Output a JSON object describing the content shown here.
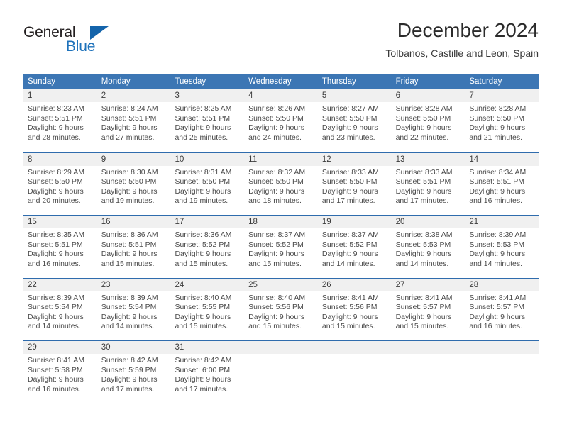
{
  "brand": {
    "name_part1": "General",
    "name_part2": "Blue",
    "accent_color": "#1464ab"
  },
  "header": {
    "title": "December 2024",
    "subtitle": "Tolbanos, Castille and Leon, Spain"
  },
  "theme": {
    "header_blue": "#3c76b4",
    "separator_blue": "#2f6cad",
    "daynum_band": "#f0f0f0"
  },
  "weekdays": [
    "Sunday",
    "Monday",
    "Tuesday",
    "Wednesday",
    "Thursday",
    "Friday",
    "Saturday"
  ],
  "weeks": [
    [
      {
        "day": "1",
        "sunrise": "Sunrise: 8:23 AM",
        "sunset": "Sunset: 5:51 PM",
        "daylight_1": "Daylight: 9 hours",
        "daylight_2": "and 28 minutes."
      },
      {
        "day": "2",
        "sunrise": "Sunrise: 8:24 AM",
        "sunset": "Sunset: 5:51 PM",
        "daylight_1": "Daylight: 9 hours",
        "daylight_2": "and 27 minutes."
      },
      {
        "day": "3",
        "sunrise": "Sunrise: 8:25 AM",
        "sunset": "Sunset: 5:51 PM",
        "daylight_1": "Daylight: 9 hours",
        "daylight_2": "and 25 minutes."
      },
      {
        "day": "4",
        "sunrise": "Sunrise: 8:26 AM",
        "sunset": "Sunset: 5:50 PM",
        "daylight_1": "Daylight: 9 hours",
        "daylight_2": "and 24 minutes."
      },
      {
        "day": "5",
        "sunrise": "Sunrise: 8:27 AM",
        "sunset": "Sunset: 5:50 PM",
        "daylight_1": "Daylight: 9 hours",
        "daylight_2": "and 23 minutes."
      },
      {
        "day": "6",
        "sunrise": "Sunrise: 8:28 AM",
        "sunset": "Sunset: 5:50 PM",
        "daylight_1": "Daylight: 9 hours",
        "daylight_2": "and 22 minutes."
      },
      {
        "day": "7",
        "sunrise": "Sunrise: 8:28 AM",
        "sunset": "Sunset: 5:50 PM",
        "daylight_1": "Daylight: 9 hours",
        "daylight_2": "and 21 minutes."
      }
    ],
    [
      {
        "day": "8",
        "sunrise": "Sunrise: 8:29 AM",
        "sunset": "Sunset: 5:50 PM",
        "daylight_1": "Daylight: 9 hours",
        "daylight_2": "and 20 minutes."
      },
      {
        "day": "9",
        "sunrise": "Sunrise: 8:30 AM",
        "sunset": "Sunset: 5:50 PM",
        "daylight_1": "Daylight: 9 hours",
        "daylight_2": "and 19 minutes."
      },
      {
        "day": "10",
        "sunrise": "Sunrise: 8:31 AM",
        "sunset": "Sunset: 5:50 PM",
        "daylight_1": "Daylight: 9 hours",
        "daylight_2": "and 19 minutes."
      },
      {
        "day": "11",
        "sunrise": "Sunrise: 8:32 AM",
        "sunset": "Sunset: 5:50 PM",
        "daylight_1": "Daylight: 9 hours",
        "daylight_2": "and 18 minutes."
      },
      {
        "day": "12",
        "sunrise": "Sunrise: 8:33 AM",
        "sunset": "Sunset: 5:50 PM",
        "daylight_1": "Daylight: 9 hours",
        "daylight_2": "and 17 minutes."
      },
      {
        "day": "13",
        "sunrise": "Sunrise: 8:33 AM",
        "sunset": "Sunset: 5:51 PM",
        "daylight_1": "Daylight: 9 hours",
        "daylight_2": "and 17 minutes."
      },
      {
        "day": "14",
        "sunrise": "Sunrise: 8:34 AM",
        "sunset": "Sunset: 5:51 PM",
        "daylight_1": "Daylight: 9 hours",
        "daylight_2": "and 16 minutes."
      }
    ],
    [
      {
        "day": "15",
        "sunrise": "Sunrise: 8:35 AM",
        "sunset": "Sunset: 5:51 PM",
        "daylight_1": "Daylight: 9 hours",
        "daylight_2": "and 16 minutes."
      },
      {
        "day": "16",
        "sunrise": "Sunrise: 8:36 AM",
        "sunset": "Sunset: 5:51 PM",
        "daylight_1": "Daylight: 9 hours",
        "daylight_2": "and 15 minutes."
      },
      {
        "day": "17",
        "sunrise": "Sunrise: 8:36 AM",
        "sunset": "Sunset: 5:52 PM",
        "daylight_1": "Daylight: 9 hours",
        "daylight_2": "and 15 minutes."
      },
      {
        "day": "18",
        "sunrise": "Sunrise: 8:37 AM",
        "sunset": "Sunset: 5:52 PM",
        "daylight_1": "Daylight: 9 hours",
        "daylight_2": "and 15 minutes."
      },
      {
        "day": "19",
        "sunrise": "Sunrise: 8:37 AM",
        "sunset": "Sunset: 5:52 PM",
        "daylight_1": "Daylight: 9 hours",
        "daylight_2": "and 14 minutes."
      },
      {
        "day": "20",
        "sunrise": "Sunrise: 8:38 AM",
        "sunset": "Sunset: 5:53 PM",
        "daylight_1": "Daylight: 9 hours",
        "daylight_2": "and 14 minutes."
      },
      {
        "day": "21",
        "sunrise": "Sunrise: 8:39 AM",
        "sunset": "Sunset: 5:53 PM",
        "daylight_1": "Daylight: 9 hours",
        "daylight_2": "and 14 minutes."
      }
    ],
    [
      {
        "day": "22",
        "sunrise": "Sunrise: 8:39 AM",
        "sunset": "Sunset: 5:54 PM",
        "daylight_1": "Daylight: 9 hours",
        "daylight_2": "and 14 minutes."
      },
      {
        "day": "23",
        "sunrise": "Sunrise: 8:39 AM",
        "sunset": "Sunset: 5:54 PM",
        "daylight_1": "Daylight: 9 hours",
        "daylight_2": "and 14 minutes."
      },
      {
        "day": "24",
        "sunrise": "Sunrise: 8:40 AM",
        "sunset": "Sunset: 5:55 PM",
        "daylight_1": "Daylight: 9 hours",
        "daylight_2": "and 15 minutes."
      },
      {
        "day": "25",
        "sunrise": "Sunrise: 8:40 AM",
        "sunset": "Sunset: 5:56 PM",
        "daylight_1": "Daylight: 9 hours",
        "daylight_2": "and 15 minutes."
      },
      {
        "day": "26",
        "sunrise": "Sunrise: 8:41 AM",
        "sunset": "Sunset: 5:56 PM",
        "daylight_1": "Daylight: 9 hours",
        "daylight_2": "and 15 minutes."
      },
      {
        "day": "27",
        "sunrise": "Sunrise: 8:41 AM",
        "sunset": "Sunset: 5:57 PM",
        "daylight_1": "Daylight: 9 hours",
        "daylight_2": "and 15 minutes."
      },
      {
        "day": "28",
        "sunrise": "Sunrise: 8:41 AM",
        "sunset": "Sunset: 5:57 PM",
        "daylight_1": "Daylight: 9 hours",
        "daylight_2": "and 16 minutes."
      }
    ],
    [
      {
        "day": "29",
        "sunrise": "Sunrise: 8:41 AM",
        "sunset": "Sunset: 5:58 PM",
        "daylight_1": "Daylight: 9 hours",
        "daylight_2": "and 16 minutes."
      },
      {
        "day": "30",
        "sunrise": "Sunrise: 8:42 AM",
        "sunset": "Sunset: 5:59 PM",
        "daylight_1": "Daylight: 9 hours",
        "daylight_2": "and 17 minutes."
      },
      {
        "day": "31",
        "sunrise": "Sunrise: 8:42 AM",
        "sunset": "Sunset: 6:00 PM",
        "daylight_1": "Daylight: 9 hours",
        "daylight_2": "and 17 minutes."
      },
      {
        "day": "",
        "sunrise": "",
        "sunset": "",
        "daylight_1": "",
        "daylight_2": ""
      },
      {
        "day": "",
        "sunrise": "",
        "sunset": "",
        "daylight_1": "",
        "daylight_2": ""
      },
      {
        "day": "",
        "sunrise": "",
        "sunset": "",
        "daylight_1": "",
        "daylight_2": ""
      },
      {
        "day": "",
        "sunrise": "",
        "sunset": "",
        "daylight_1": "",
        "daylight_2": ""
      }
    ]
  ]
}
